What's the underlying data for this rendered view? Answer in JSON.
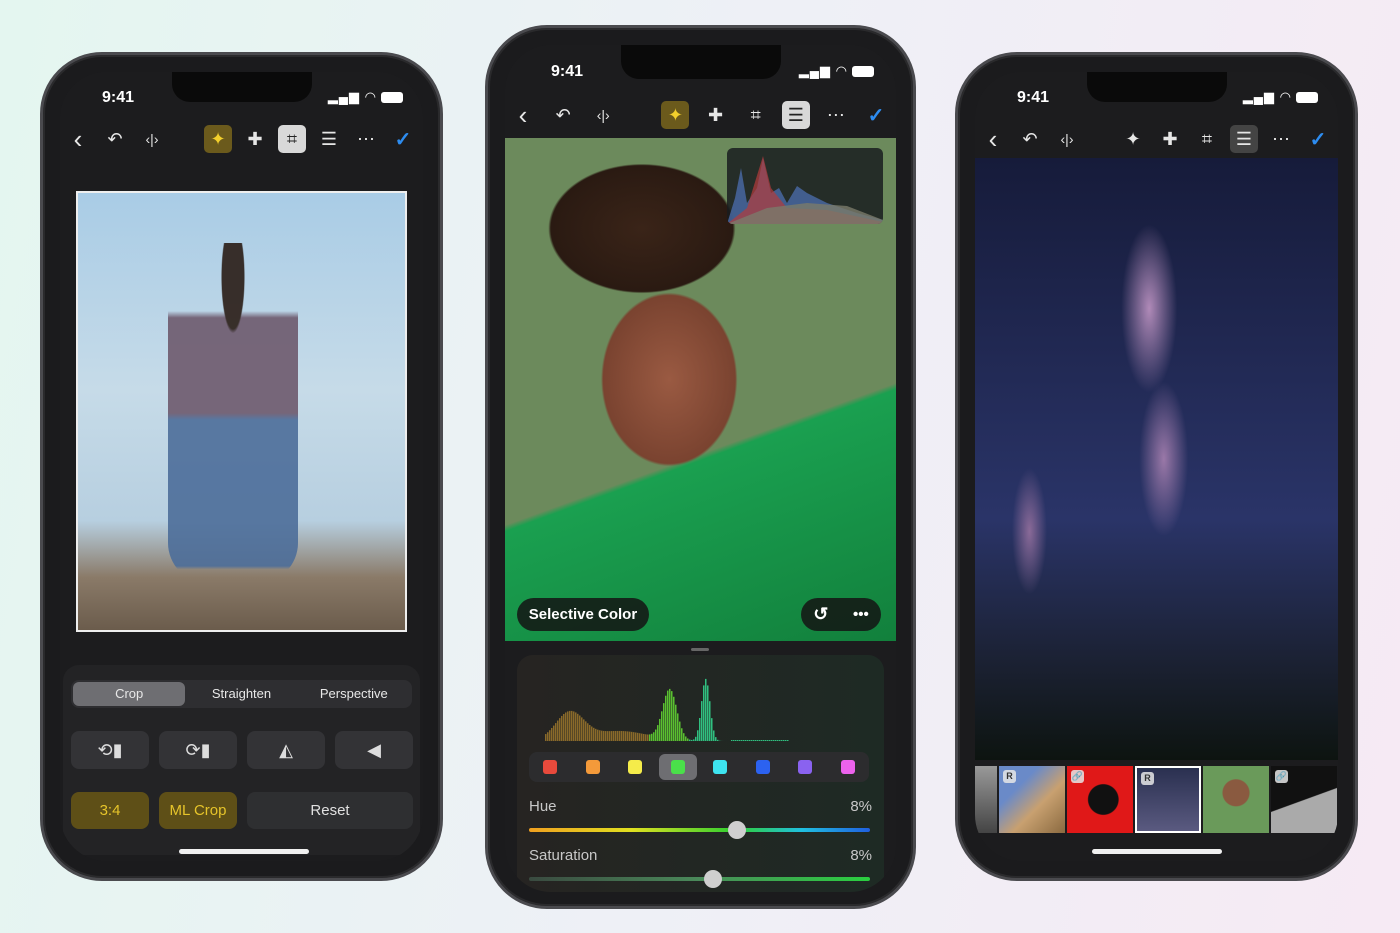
{
  "status": {
    "time": "9:41",
    "signal": "signal-icon",
    "wifi": "wifi-icon",
    "battery": "battery-icon"
  },
  "toolbar": {
    "back": "‹",
    "undo": "↶",
    "compare": "‹|›",
    "ml": "✦",
    "heal": "✚",
    "crop": "⌗",
    "adjust": "☰",
    "more": "⋯",
    "done": "✓"
  },
  "left_phone": {
    "crop_tabs": [
      {
        "label": "Crop",
        "active": true
      },
      {
        "label": "Straighten",
        "active": false
      },
      {
        "label": "Perspective",
        "active": false
      }
    ],
    "tools": [
      "rotate-left-icon",
      "rotate-right-icon",
      "flip-horizontal-icon",
      "flip-vertical-icon"
    ],
    "aspect_label": "3:4",
    "ml_crop_label": "ML Crop",
    "reset_label": "Reset"
  },
  "middle_phone": {
    "tool_title": "Selective Color",
    "swatches": [
      {
        "color": "#e84a3c"
      },
      {
        "color": "#f49a3a"
      },
      {
        "color": "#f5ec4a"
      },
      {
        "color": "#4ae04a",
        "selected": true
      },
      {
        "color": "#3ee4f0"
      },
      {
        "color": "#2c62f0"
      },
      {
        "color": "#8a62f0"
      },
      {
        "color": "#ec62ec"
      }
    ],
    "hue": {
      "label": "Hue",
      "value": "8%",
      "position": 0.61
    },
    "saturation": {
      "label": "Saturation",
      "value": "8%",
      "position": 0.54
    }
  },
  "right_phone": {
    "filmstrip": [
      {
        "badge": ""
      },
      {
        "badge": "R"
      },
      {
        "badge": "🔗"
      },
      {
        "badge": "R",
        "selected": true
      },
      {
        "badge": ""
      },
      {
        "badge": "🔗"
      }
    ]
  },
  "colors": {
    "accent": "#2d8cf0",
    "ml": "#e6c42a"
  }
}
